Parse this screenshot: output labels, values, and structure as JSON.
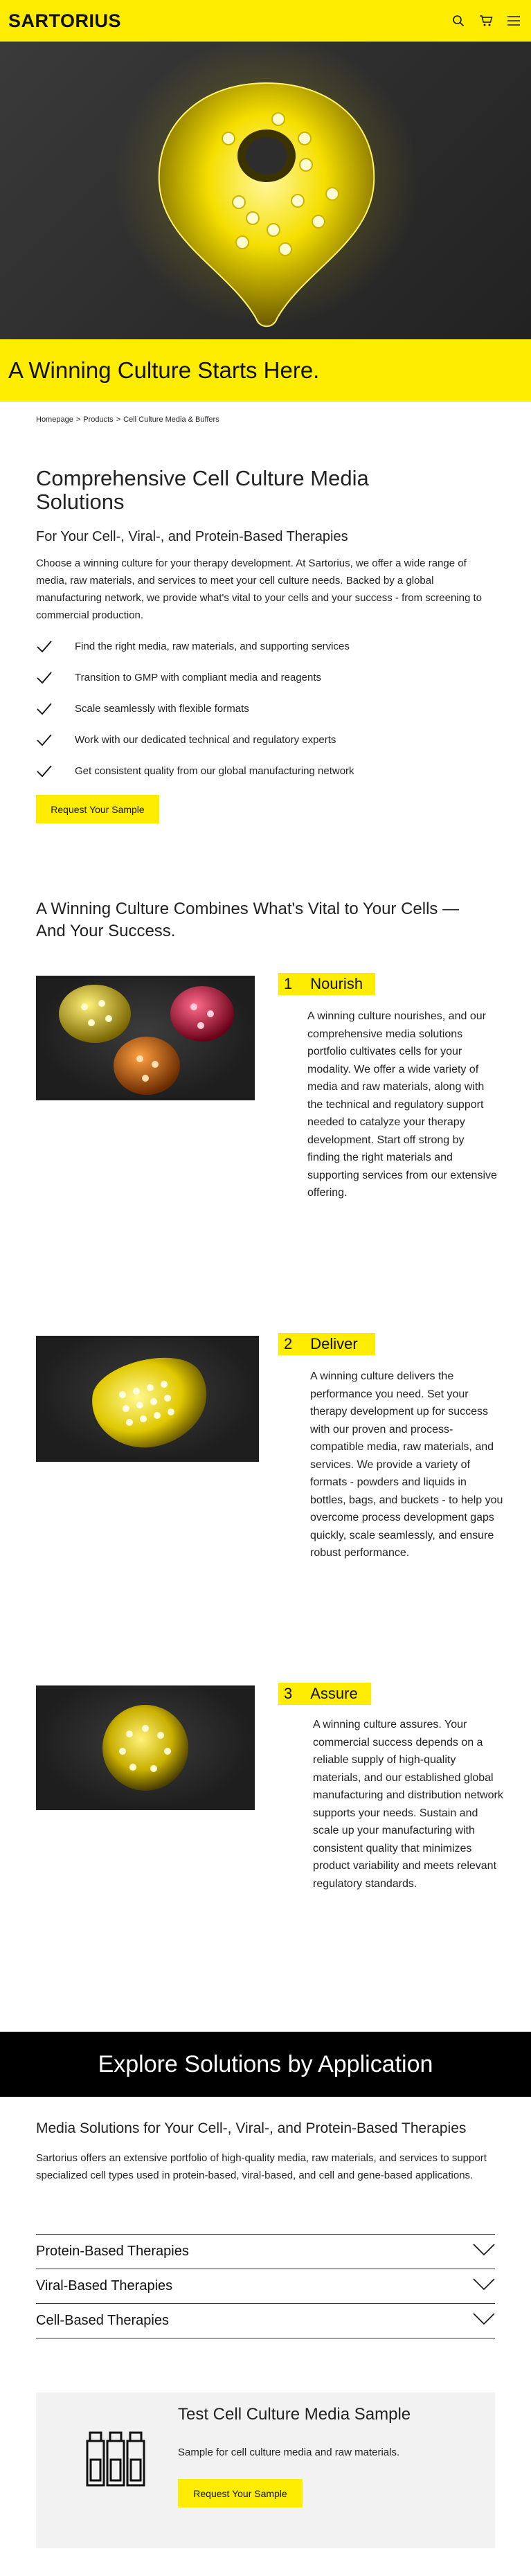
{
  "header": {
    "logo": "SARTORIUS",
    "icons": [
      "search-icon",
      "cart-icon",
      "menu-icon"
    ]
  },
  "hero": {
    "title": "A Winning Culture Starts Here."
  },
  "breadcrumb": [
    "Homepage",
    "Products",
    "Cell Culture Media & Buffers"
  ],
  "breadcrumb_separator": ">",
  "intro": {
    "title": "Comprehensive Cell Culture Media Solutions",
    "subtitle": "For Your Cell-, Viral-, and Protein-Based Therapies",
    "body": "Choose a winning culture for your therapy development. At Sartorius, we offer a wide range of media, raw materials, and services to meet your cell culture needs. Backed by a global manufacturing network, we provide what's vital to your cells and your success - from screening to commercial production.",
    "checklist": [
      "Find the right media, raw materials, and supporting services",
      "Transition to GMP with compliant media and reagents",
      "Scale seamlessly with flexible formats",
      "Work with our dedicated technical and regulatory experts",
      "Get consistent quality from our global manufacturing network"
    ],
    "button": "Request Your Sample"
  },
  "vital": {
    "title": "A Winning Culture Combines What's Vital to Your Cells — And Your Success."
  },
  "features": [
    {
      "number": "1",
      "label": "Nourish",
      "text": "A winning culture nourishes, and our comprehensive media solutions portfolio cultivates cells for your modality. We offer a wide variety of media and raw materials, along with the technical and regulatory support needed to catalyze your therapy development. Start off strong by finding the right materials and supporting services from our extensive offering."
    },
    {
      "number": "2",
      "label": "Deliver",
      "text": "A winning culture delivers the performance you need. Set your therapy development up for success with our proven and process-compatible media, raw materials, and services. We provide a variety of formats - powders and liquids in bottles, bags, and buckets - to help you overcome process development gaps quickly, scale seamlessly, and ensure robust performance."
    },
    {
      "number": "3",
      "label": "Assure",
      "text": "A winning culture assures. Your commercial success depends on a reliable supply of high-quality materials, and our established global manufacturing and distribution network supports your needs. Sustain and scale up your manufacturing with consistent quality that minimizes product variability and meets relevant regulatory standards."
    }
  ],
  "explore": {
    "title": "Explore Solutions by Application"
  },
  "media": {
    "title": "Media Solutions for Your Cell-, Viral-, and Protein-Based Therapies",
    "body": "Sartorius offers an extensive portfolio of high-quality media, raw materials, and services to support specialized cell types used in protein-based, viral-based, and cell and gene-based applications."
  },
  "accordion": [
    "Protein-Based Therapies",
    "Viral-Based Therapies",
    "Cell-Based Therapies"
  ],
  "sample": {
    "title": "Test Cell Culture Media Sample",
    "body": "Sample for cell culture media and raw materials.",
    "button": "Request Your Sample"
  },
  "colors": {
    "brand_yellow": "#FFED00",
    "black": "#000000"
  }
}
